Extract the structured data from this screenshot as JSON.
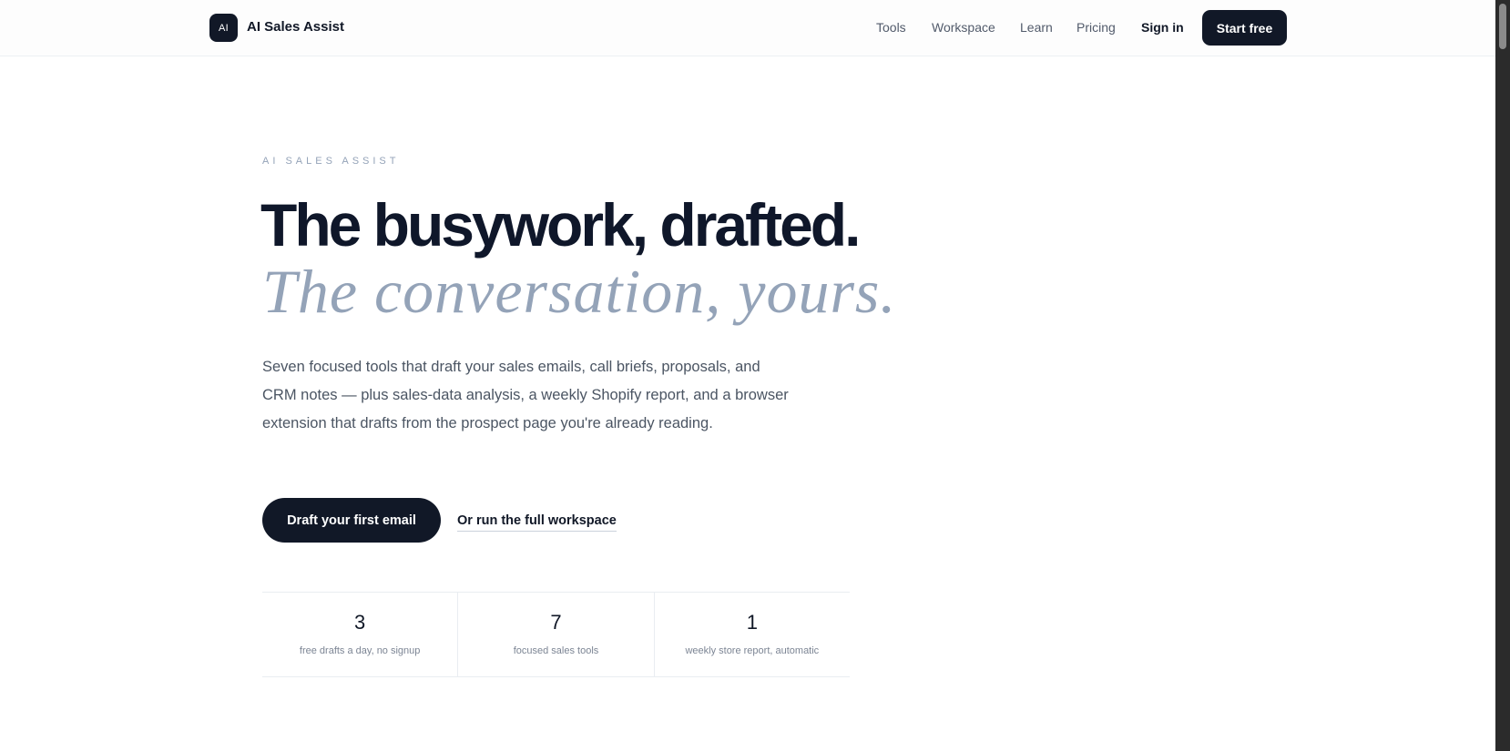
{
  "header": {
    "logo_text": "AI",
    "brand_name": "AI Sales Assist",
    "nav": {
      "tools": "Tools",
      "workspace": "Workspace",
      "learn": "Learn",
      "pricing": "Pricing",
      "sign_in": "Sign in"
    },
    "cta_label": "Start free"
  },
  "hero": {
    "eyebrow": "AI SALES ASSIST",
    "headline": "The busywork, drafted.",
    "headline_italic": "The conversation, yours.",
    "lede": "Seven focused tools that draft your sales emails, call briefs, proposals, and CRM notes — plus sales-data analysis, a weekly Shopify report, and a browser extension that drafts from the prospect page you're already reading.",
    "primary_cta": "Draft your first email",
    "secondary_cta": "Or run the full workspace"
  },
  "stats": [
    {
      "value": "3",
      "label": "free drafts a day, no signup"
    },
    {
      "value": "7",
      "label": "focused sales tools"
    },
    {
      "value": "1",
      "label": "weekly store report, automatic"
    }
  ],
  "colors": {
    "primary_dark": "#111827",
    "muted_slate": "#94a3b8",
    "body_text": "#4b5563"
  }
}
